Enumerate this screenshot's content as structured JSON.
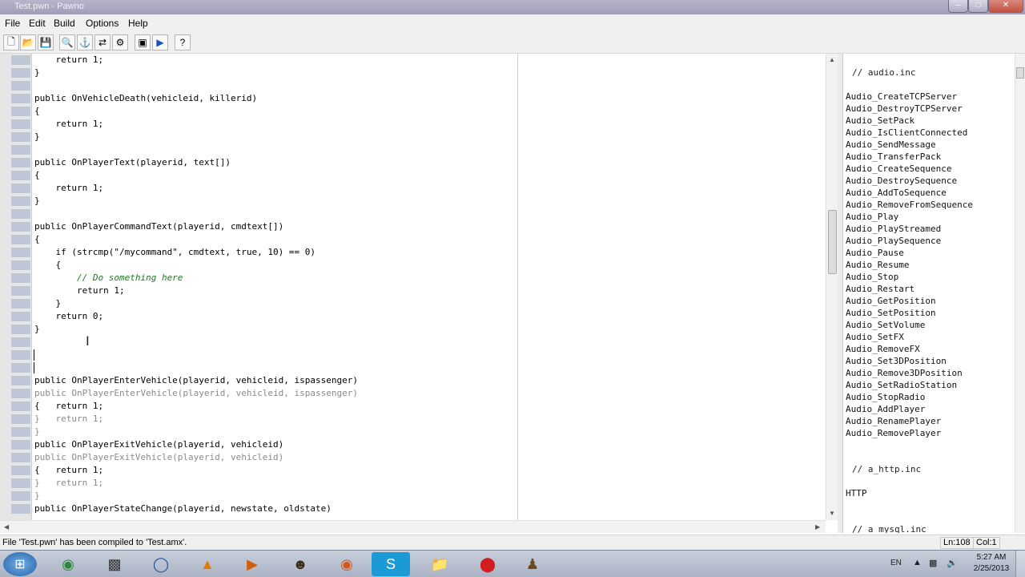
{
  "window": {
    "title": "Test.pwn - Pawno"
  },
  "menu": [
    "File",
    "Edit",
    "Build",
    "Options",
    "Help"
  ],
  "toolbar": {
    "icons": [
      "new-file-icon",
      "open-file-icon",
      "save-icon",
      "find-icon",
      "find-next-icon",
      "replace-icon",
      "settings-icon",
      "compile-icon",
      "run-icon",
      "help-icon"
    ]
  },
  "editor": {
    "line_numbers": [
      "",
      "",
      "",
      "",
      "",
      "",
      "",
      "",
      "",
      "",
      "",
      "",
      "",
      "",
      "",
      "",
      "",
      "",
      "",
      "",
      "",
      "",
      "",
      "",
      "",
      "",
      "",
      "",
      "",
      "",
      "",
      "",
      "",
      "",
      "",
      ""
    ],
    "lines": [
      {
        "text": "    return 1;",
        "style": ""
      },
      {
        "text": "}",
        "style": ""
      },
      {
        "text": "",
        "style": ""
      },
      {
        "text": "public OnVehicleDeath(vehicleid, killerid)",
        "style": ""
      },
      {
        "text": "{",
        "style": ""
      },
      {
        "text": "    return 1;",
        "style": ""
      },
      {
        "text": "}",
        "style": ""
      },
      {
        "text": "",
        "style": ""
      },
      {
        "text": "public OnPlayerText(playerid, text[])",
        "style": ""
      },
      {
        "text": "{",
        "style": ""
      },
      {
        "text": "    return 1;",
        "style": ""
      },
      {
        "text": "}",
        "style": ""
      },
      {
        "text": "",
        "style": ""
      },
      {
        "text": "public OnPlayerCommandText(playerid, cmdtext[])",
        "style": ""
      },
      {
        "text": "{",
        "style": ""
      },
      {
        "text": "    if (strcmp(\"/mycommand\", cmdtext, true, 10) == 0)",
        "style": ""
      },
      {
        "text": "    {",
        "style": ""
      },
      {
        "text": "        // Do something here",
        "style": "comment"
      },
      {
        "text": "        return 1;",
        "style": ""
      },
      {
        "text": "    }",
        "style": ""
      },
      {
        "text": "    return 0;",
        "style": ""
      },
      {
        "text": "}",
        "style": ""
      },
      {
        "text": "",
        "style": ""
      },
      {
        "text": "",
        "style": ""
      },
      {
        "text": "",
        "style": ""
      },
      {
        "text": "public OnPlayerEnterVehicle(playerid, vehicleid, ispassenger)",
        "style": ""
      },
      {
        "text": "public OnPlayerEnterVehicle(playerid, vehicleid, ispassenger)",
        "style": "ghost"
      },
      {
        "text": "{   return 1;",
        "style": ""
      },
      {
        "text": "}   return 1;",
        "style": "ghost"
      },
      {
        "text": "}",
        "style": "ghost"
      },
      {
        "text": "public OnPlayerExitVehicle(playerid, vehicleid)",
        "style": ""
      },
      {
        "text": "public OnPlayerExitVehicle(playerid, vehicleid)",
        "style": "ghost"
      },
      {
        "text": "{   return 1;",
        "style": ""
      },
      {
        "text": "}   return 1;",
        "style": "ghost"
      },
      {
        "text": "}",
        "style": "ghost"
      },
      {
        "text": "public OnPlayerStateChange(playerid, newstate, oldstate)",
        "style": ""
      }
    ]
  },
  "function_list": {
    "sections": [
      {
        "header": "// audio.inc",
        "items": [
          "Audio_CreateTCPServer",
          "Audio_DestroyTCPServer",
          "Audio_SetPack",
          "Audio_IsClientConnected",
          "Audio_SendMessage",
          "Audio_TransferPack",
          "Audio_CreateSequence",
          "Audio_DestroySequence",
          "Audio_AddToSequence",
          "Audio_RemoveFromSequence",
          "Audio_Play",
          "Audio_PlayStreamed",
          "Audio_PlaySequence",
          "Audio_Pause",
          "Audio_Resume",
          "Audio_Stop",
          "Audio_Restart",
          "Audio_GetPosition",
          "Audio_SetPosition",
          "Audio_SetVolume",
          "Audio_SetFX",
          "Audio_RemoveFX",
          "Audio_Set3DPosition",
          "Audio_Remove3DPosition",
          "Audio_SetRadioStation",
          "Audio_StopRadio",
          "Audio_AddPlayer",
          "Audio_RenamePlayer",
          "Audio_RemovePlayer"
        ]
      },
      {
        "header": "// a_http.inc",
        "items": [
          "HTTP"
        ]
      },
      {
        "header": "// a_mysql.inc",
        "items": []
      }
    ]
  },
  "status": {
    "message": "File 'Test.pwn' has been compiled to 'Test.amx'.",
    "line": "Ln:108",
    "col": "Col:1"
  },
  "taskbar": {
    "apps": [
      "explorer-icon",
      "console-icon",
      "media-icon",
      "vlc-icon",
      "player-icon",
      "game-icon",
      "firefox-icon",
      "skype-icon",
      "folder-icon",
      "record-icon",
      "chess-icon"
    ],
    "language": "EN",
    "time": "5:27 AM",
    "date": "2/25/2013"
  }
}
